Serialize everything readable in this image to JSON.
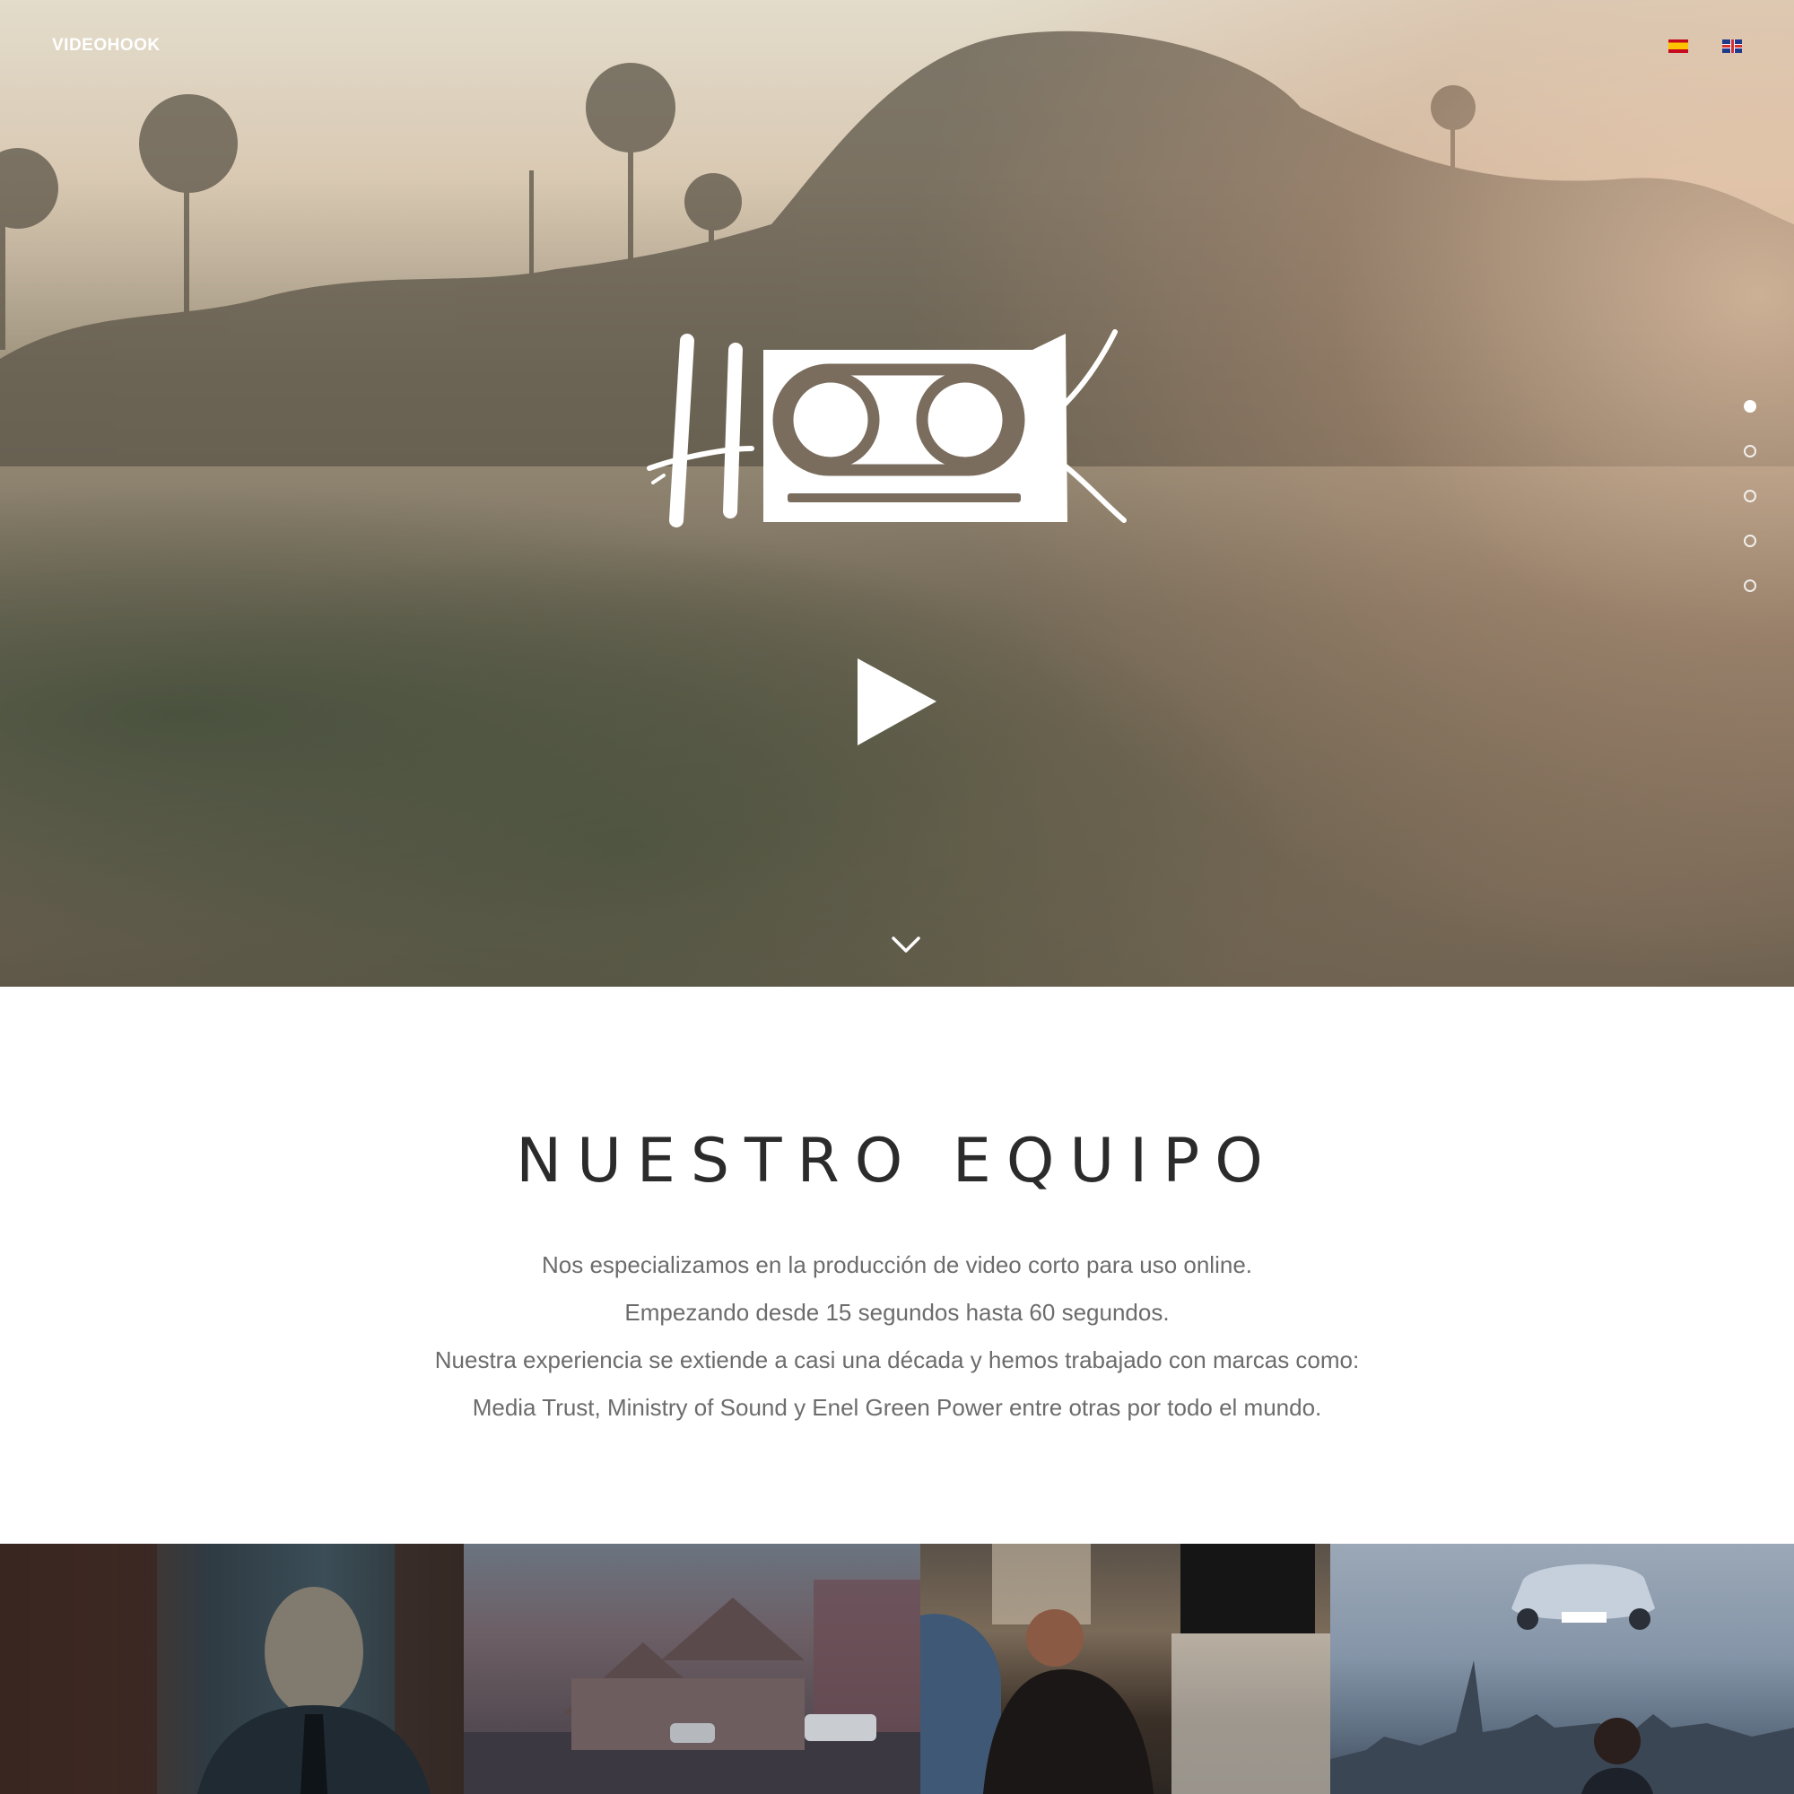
{
  "header": {
    "brand": "VIDEOHOOK",
    "languages": [
      {
        "code": "es",
        "icon": "spain-flag-icon"
      },
      {
        "code": "en",
        "icon": "uk-flag-icon"
      }
    ]
  },
  "hero": {
    "logo_text": "HOOK",
    "play_icon": "play-icon",
    "scroll_icon": "chevron-down-icon",
    "slide_count": 5,
    "active_slide": 1
  },
  "team": {
    "title": "NUESTRO EQUIPO",
    "lines": [
      "Nos especializamos en la producción de video corto para uso online.",
      "Empezando desde 15 segundos hasta 60 segundos.",
      "Nuestra experiencia se extiende a casi una década y hemos trabajado con marcas como:",
      "Media Trust, Ministry of Sound y Enel Green Power entre otras por todo el mundo."
    ]
  },
  "colors": {
    "title": "#2b2b2b",
    "body_text": "#6c6c6c",
    "hero_overlay_text": "#ffffff"
  }
}
